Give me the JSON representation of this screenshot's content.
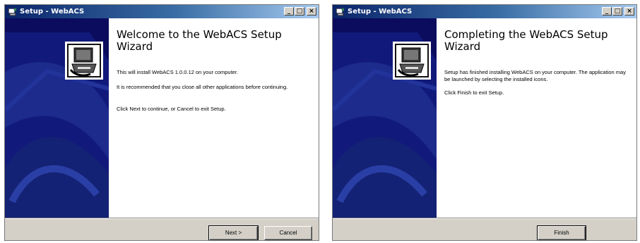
{
  "window1": {
    "title": "Setup - WebACS",
    "heading": "Welcome to the WebACS Setup Wizard",
    "paragraphs": [
      "This will install WebACS 1.0.0.12 on your computer.",
      "It is recommended that you close all other applications before continuing.",
      "Click Next to continue, or Cancel to exit Setup."
    ],
    "buttons": {
      "next": "Next >",
      "cancel": "Cancel"
    }
  },
  "window2": {
    "title": "Setup - WebACS",
    "heading": "Completing the WebACS Setup Wizard",
    "paragraphs": [
      "Setup has finished installing WebACS on your computer. The application may be launched by selecting the installed icons.",
      "Click Finish to exit Setup."
    ],
    "buttons": {
      "finish": "Finish"
    }
  },
  "colors": {
    "panel_dark": "#0b0c5e",
    "panel_mid": "#1c2b8c",
    "titlebar": "#0a246a",
    "chrome": "#d4d0c8"
  },
  "icons": {
    "app": "setup-app-icon",
    "wizard": "computer-install-icon",
    "minimize": "minimize-icon",
    "maximize": "maximize-icon",
    "close": "close-icon"
  }
}
